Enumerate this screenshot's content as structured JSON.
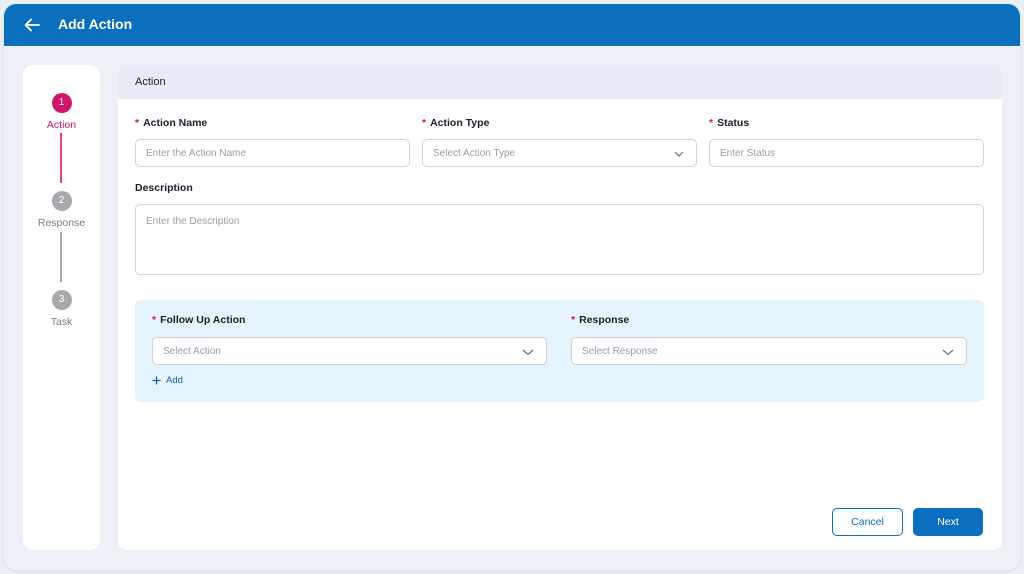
{
  "header": {
    "title": "Add Action",
    "back_icon": "arrow-left-icon"
  },
  "stepper": {
    "steps": [
      {
        "number": "1",
        "label": "Action",
        "state": "active"
      },
      {
        "number": "2",
        "label": "Response",
        "state": "inactive"
      },
      {
        "number": "3",
        "label": "Task",
        "state": "inactive"
      }
    ]
  },
  "section": {
    "title": "Action"
  },
  "form": {
    "required_mark": "*",
    "action_name": {
      "label": "Action Name",
      "placeholder": "Enter the Action Name"
    },
    "action_type": {
      "label": "Action Type",
      "placeholder": "Select Action Type"
    },
    "status": {
      "label": "Status",
      "placeholder": "Enter Status"
    },
    "description": {
      "label": "Description",
      "placeholder": "Enter the Description"
    }
  },
  "follow_up": {
    "action": {
      "label": "Follow Up Action",
      "placeholder": "Select Action"
    },
    "response": {
      "label": "Response",
      "placeholder": "Select Response"
    },
    "add_label": "Add"
  },
  "footer": {
    "cancel_label": "Cancel",
    "next_label": "Next"
  },
  "colors": {
    "primary": "#0b6fbf",
    "active_step": "#d1146c",
    "inactive_step": "#a9a9ad",
    "follow_up_bg": "#e4f3fc"
  }
}
